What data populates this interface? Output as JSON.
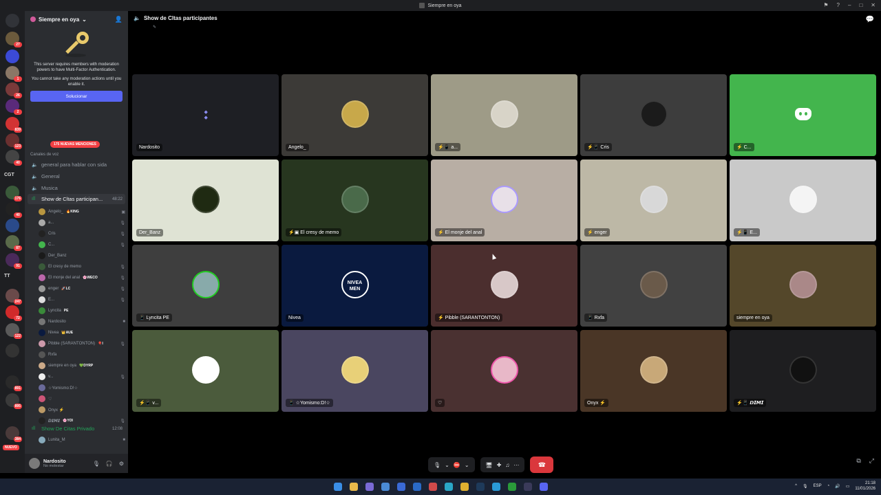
{
  "window": {
    "title": "Siempre en oya"
  },
  "server": {
    "name": "Siempre en oya",
    "mfa_text_1": "This server requires members with moderation powers to have Multi-Factor Authentication.",
    "mfa_text_2": "You cannot take any moderation actions until you enable it.",
    "solve_button": "Solucionar",
    "mentions_badge": "175 NUEVAS MENCIONES",
    "voice_category": "Canales de voz"
  },
  "guild_rail": {
    "badges": [
      "27",
      "1",
      "26",
      "2",
      "839",
      "123",
      "40",
      "176",
      "40",
      "87",
      "91",
      "247",
      "72",
      "122",
      "891",
      "895",
      "384"
    ],
    "text_item": "CGT",
    "text_item_2": "TT",
    "new_badge": "NUEVO"
  },
  "channels": [
    {
      "name": "general para hablar con sida"
    },
    {
      "name": "General"
    },
    {
      "name": "Musica"
    },
    {
      "name": "Show de Cltas participan...",
      "timer": "48:22"
    }
  ],
  "voice_users": [
    {
      "name": "Angelo_",
      "tag": "🔥KING"
    },
    {
      "name": "a...",
      "tag": ""
    },
    {
      "name": "Cris",
      "tag": ""
    },
    {
      "name": "C...",
      "tag": ""
    },
    {
      "name": "Der_Banz",
      "tag": ""
    },
    {
      "name": "El cresy de memo",
      "tag": ""
    },
    {
      "name": "El monje del anal",
      "tag": "🌸WECO"
    },
    {
      "name": "enger",
      "tag": "🚀LC"
    },
    {
      "name": "E...",
      "tag": ""
    },
    {
      "name": "Lyncita",
      "tag": "PE"
    },
    {
      "name": "Nardosito",
      "tag": ""
    },
    {
      "name": "Nivea",
      "tag": "👑AUE"
    },
    {
      "name": "Pibble (SARANTONTON)",
      "tag": "🎈I"
    },
    {
      "name": "Rxfa",
      "tag": ""
    },
    {
      "name": "siempre en oya",
      "tag": "💚DYRP"
    },
    {
      "name": "v...",
      "tag": ""
    },
    {
      "name": "☆Yomismo:D!☆",
      "tag": ""
    },
    {
      "name": "♡",
      "tag": ""
    },
    {
      "name": "Onyx ⚡",
      "tag": ""
    },
    {
      "name": "𝘿𝙄𝙈𝙄",
      "tag": "🌸YOI"
    }
  ],
  "private_channel": {
    "name": "Show De Citas Privado",
    "timer": "12:08",
    "user": "Lunita_M"
  },
  "current_user": {
    "name": "Nardosito",
    "status": "No molestar"
  },
  "stage": {
    "channel_title": "Show de Cltas participantes"
  },
  "tiles": [
    {
      "name": "Nardosito",
      "bg": "#1e1f24"
    },
    {
      "name": "Angelo_",
      "bg": "#3c3a37"
    },
    {
      "name": "a...",
      "bg": "#9e9b87"
    },
    {
      "name": "Cris",
      "bg": "#3d3d3d"
    },
    {
      "name": "C...",
      "bg": "#43b54d"
    },
    {
      "name": "Der_Banz",
      "bg": "#dfe3d4"
    },
    {
      "name": "El cresy de memo",
      "bg": "#27361f"
    },
    {
      "name": "El monje del anal",
      "bg": "#b8aea4"
    },
    {
      "name": "enger",
      "bg": "#bdb8a6"
    },
    {
      "name": "E...",
      "bg": "#c9c9c9"
    },
    {
      "name": "Lyncita PE",
      "bg": "#3e3e3e"
    },
    {
      "name": "Nivea",
      "bg": "#0a1a3f"
    },
    {
      "name": "Pibble (SARANTONTON)",
      "bg": "#4b2e2e"
    },
    {
      "name": "Rxfa",
      "bg": "#414141"
    },
    {
      "name": "siempre en oya",
      "bg": "#54472a"
    },
    {
      "name": "v...",
      "bg": "#4b5b3c"
    },
    {
      "name": "☆Yomismo:D!☆",
      "bg": "#4a4660"
    },
    {
      "name": "♡",
      "bg": "#4a3131"
    },
    {
      "name": "Onyx ⚡",
      "bg": "#4a3626"
    },
    {
      "name": "𝘿𝙄𝙈𝙄",
      "bg": "#1e1e20"
    }
  ],
  "nivea_logo": {
    "line1": "NIVEA",
    "line2": "MEN"
  },
  "taskbar": {
    "lang": "ESP",
    "time": "21:18",
    "date": "11/01/2026"
  }
}
